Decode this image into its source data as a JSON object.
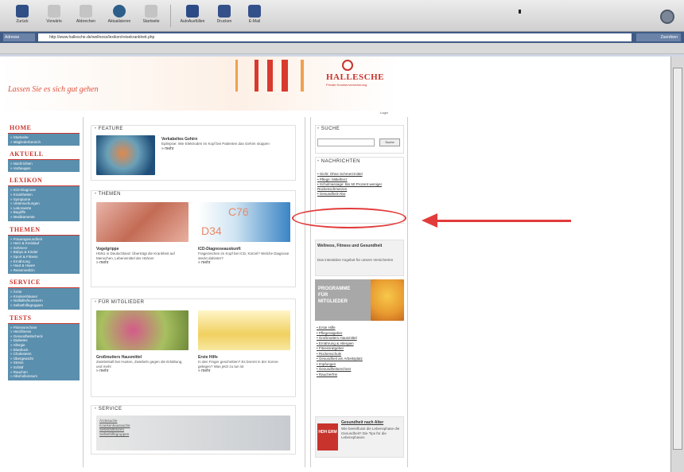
{
  "toolbar": {
    "buttons": [
      {
        "label": "Zurück",
        "icon": "back-arrow-icon"
      },
      {
        "label": "Vorwärts",
        "icon": "forward-arrow-icon"
      },
      {
        "label": "Abbrechen",
        "icon": "stop-icon"
      },
      {
        "label": "Aktualisieren",
        "icon": "refresh-icon"
      },
      {
        "label": "Startseite",
        "icon": "home-icon"
      },
      {
        "label": "AutoAusfüllen",
        "icon": "autofill-icon"
      },
      {
        "label": "Drucken",
        "icon": "print-icon"
      },
      {
        "label": "E-Mail",
        "icon": "mail-icon"
      }
    ]
  },
  "address": {
    "label": "Adresse",
    "url": "http://www.hallesche.de/wellness/lexikon/reisekrankheit.php",
    "go": "Zuordnen"
  },
  "site": {
    "slogan": "Lassen Sie es sich gut gehen",
    "logo": "HALLESCHE",
    "logo_sub": "Private Krankenversicherung",
    "login": "Login"
  },
  "nav": [
    {
      "head": "HOME",
      "items": [
        "Startseite",
        "Mitgliederbereich"
      ]
    },
    {
      "head": "AKTUELL",
      "items": [
        "Nachrichten",
        "Vorbeugen"
      ]
    },
    {
      "head": "LEXIKON",
      "items": [
        "ICD-Diagnose",
        "Krankheiten",
        "Symptome",
        "Untersuchungen",
        "Laborwerte",
        "Begriffe",
        "Medikamente"
      ]
    },
    {
      "head": "THEMEN",
      "items": [
        "Frauengesundheit",
        "Herz & Kreislauf",
        "Schmerz",
        "Babys & Kinder",
        "Sport & Fitness",
        "Ernährung",
        "Haut & Haare",
        "Reisemedizin"
      ]
    },
    {
      "head": "SERVICE",
      "items": [
        "Ärzte",
        "Krankenhäuser",
        "Notfallrufnummern",
        "Selbsthilfegruppen"
      ]
    },
    {
      "head": "TESTS",
      "items": [
        "Fitnessrechner",
        "Herzfitness",
        "Gesundheitscheck",
        "Diabetes",
        "Allergie",
        "Blutdruck",
        "Cholesterin",
        "Übergewicht",
        "Stress",
        "Schlaf",
        "Rauchen",
        "Alkoholkonsum"
      ]
    }
  ],
  "feature": {
    "title": "FEATURE",
    "headline": "Verkabeltes Gehirn",
    "text": "Epilepsie: Wie Elektroden im Kopf bei Patienten das Gehirn stoppen",
    "more": "» mehr"
  },
  "themen": {
    "title": "THEMEN",
    "items": [
      {
        "headline": "Vogelgrippe",
        "text": "H5N1 in Deutschland: Überträgt die Krankheit auf Menschen, Lebensmittel der Hühner",
        "more": "» mehr"
      },
      {
        "headline": "ICD-Diagnoseauskunft",
        "text": "Fragezeichen im Kopf bei ICD, Kürzel? Welche Diagnose steckt dahinter?",
        "more": "» mehr",
        "img_text_1": "C76",
        "img_text_2": "D34"
      }
    ]
  },
  "mitglieder": {
    "title": "FÜR MITGLIEDER",
    "items": [
      {
        "headline": "Großmutters Hausmittel",
        "text": "Zwiebelsaft bei Husten, Zwiebeln gegen die Erkältung, und mehr",
        "more": "» mehr"
      },
      {
        "headline": "Erste Hilfe",
        "text": "In den Finger geschnitten? Es brennt in der Sonne gelegen? Was jetzt zu tun ist",
        "more": "» mehr"
      }
    ]
  },
  "service": {
    "title": "SERVICE",
    "items": [
      "Ärztesuche",
      "Krankenhaussuche",
      "Selbsthilfeforen",
      "Selbsthilfegruppen"
    ]
  },
  "right": {
    "search_title": "SUCHE",
    "search_button": "Suche",
    "news_title": "NACHRICHTEN",
    "news": [
      "Gicht: Ohne Schmerzmittel",
      "Pflege: Mittelherz",
      "Schulmassage: Bis 50 Prozent weniger Rückenschmerzen",
      "Gesundheit-Abo"
    ],
    "wellness_title": "Wellness, Fitness und Gesundheit",
    "wellness_text": "Das interaktive Angebot für unsere Versicherten",
    "promo": [
      "PROGRAMME",
      "FÜR",
      "MITGLIEDER"
    ],
    "links": [
      "Erste Hilfe",
      "Pflegeratgeber",
      "Großmutters Hausmittel",
      "Ernährung & Allergien",
      "Fitnessratgeber",
      "Rückenschule",
      "Gesundheit am Arbeitsplatz",
      "Impfungen",
      "Gesundheitsrechner",
      "Raucherfrei"
    ],
    "footer_title": "Gesundheit nach Alter",
    "footer_text": "Wie beeinflusst die Lebensphase die Gesundheit? Die Tips für die Lebensphasen",
    "footer_badge": "HDH ERM"
  },
  "colors": {
    "accent_red": "#c8332c",
    "nav_blue": "#5b8fae",
    "annotation_red": "#e23b3b"
  }
}
